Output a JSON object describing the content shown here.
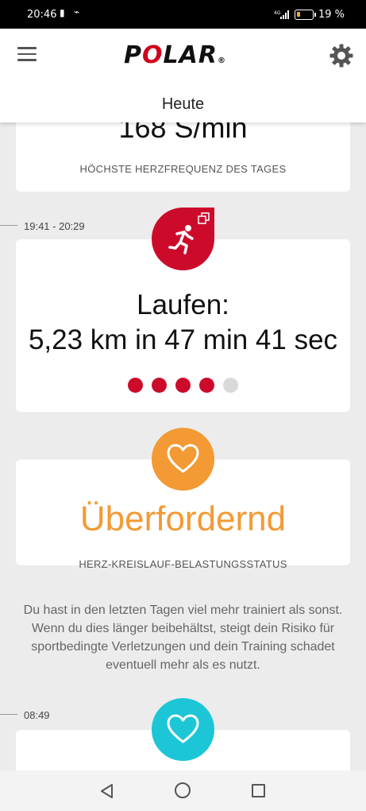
{
  "status_bar": {
    "time": "20:46",
    "network": "4G",
    "battery_percent": "19 %",
    "battery_level": 0.19
  },
  "app_bar": {
    "logo_text_1": "P",
    "logo_text_2": "O",
    "logo_text_3": "LAR",
    "logo_reg": "®"
  },
  "subheader": {
    "title": "Heute"
  },
  "cards": {
    "heart_rate": {
      "value": "168 S/min",
      "label": "HÖCHSTE HERZFREQUENZ DES TAGES"
    },
    "session": {
      "time": "19:41 - 20:29",
      "title_line1": "Laufen:",
      "title_line2": "5,23 km in 47 min 41 sec",
      "dots": [
        true,
        true,
        true,
        true,
        false
      ],
      "dot_colors": {
        "active": "#cc0b2b",
        "inactive": "#d9d9d9"
      }
    },
    "load_status": {
      "status": "Überfordernd",
      "label": "HERZ-KREISLAUF-BELASTUNGSSTATUS",
      "color": "#f39a35",
      "description": "Du hast in den letzten Tagen viel mehr trainiert als sonst. Wenn du dies länger beibehältst, steigt dein Risiko für sportbedingte Verletzungen und dein Training schadet eventuell mehr als es nutzt."
    },
    "next_entry": {
      "time": "08:49",
      "color": "#1cc6d6"
    }
  },
  "icons": {
    "menu": "menu-icon",
    "settings": "gear-icon",
    "activity": "running-icon",
    "heart": "heart-icon"
  },
  "colors": {
    "brand_red": "#cc0b2b",
    "orange": "#f39a35",
    "cyan": "#1cc6d6",
    "background": "#ececec"
  }
}
